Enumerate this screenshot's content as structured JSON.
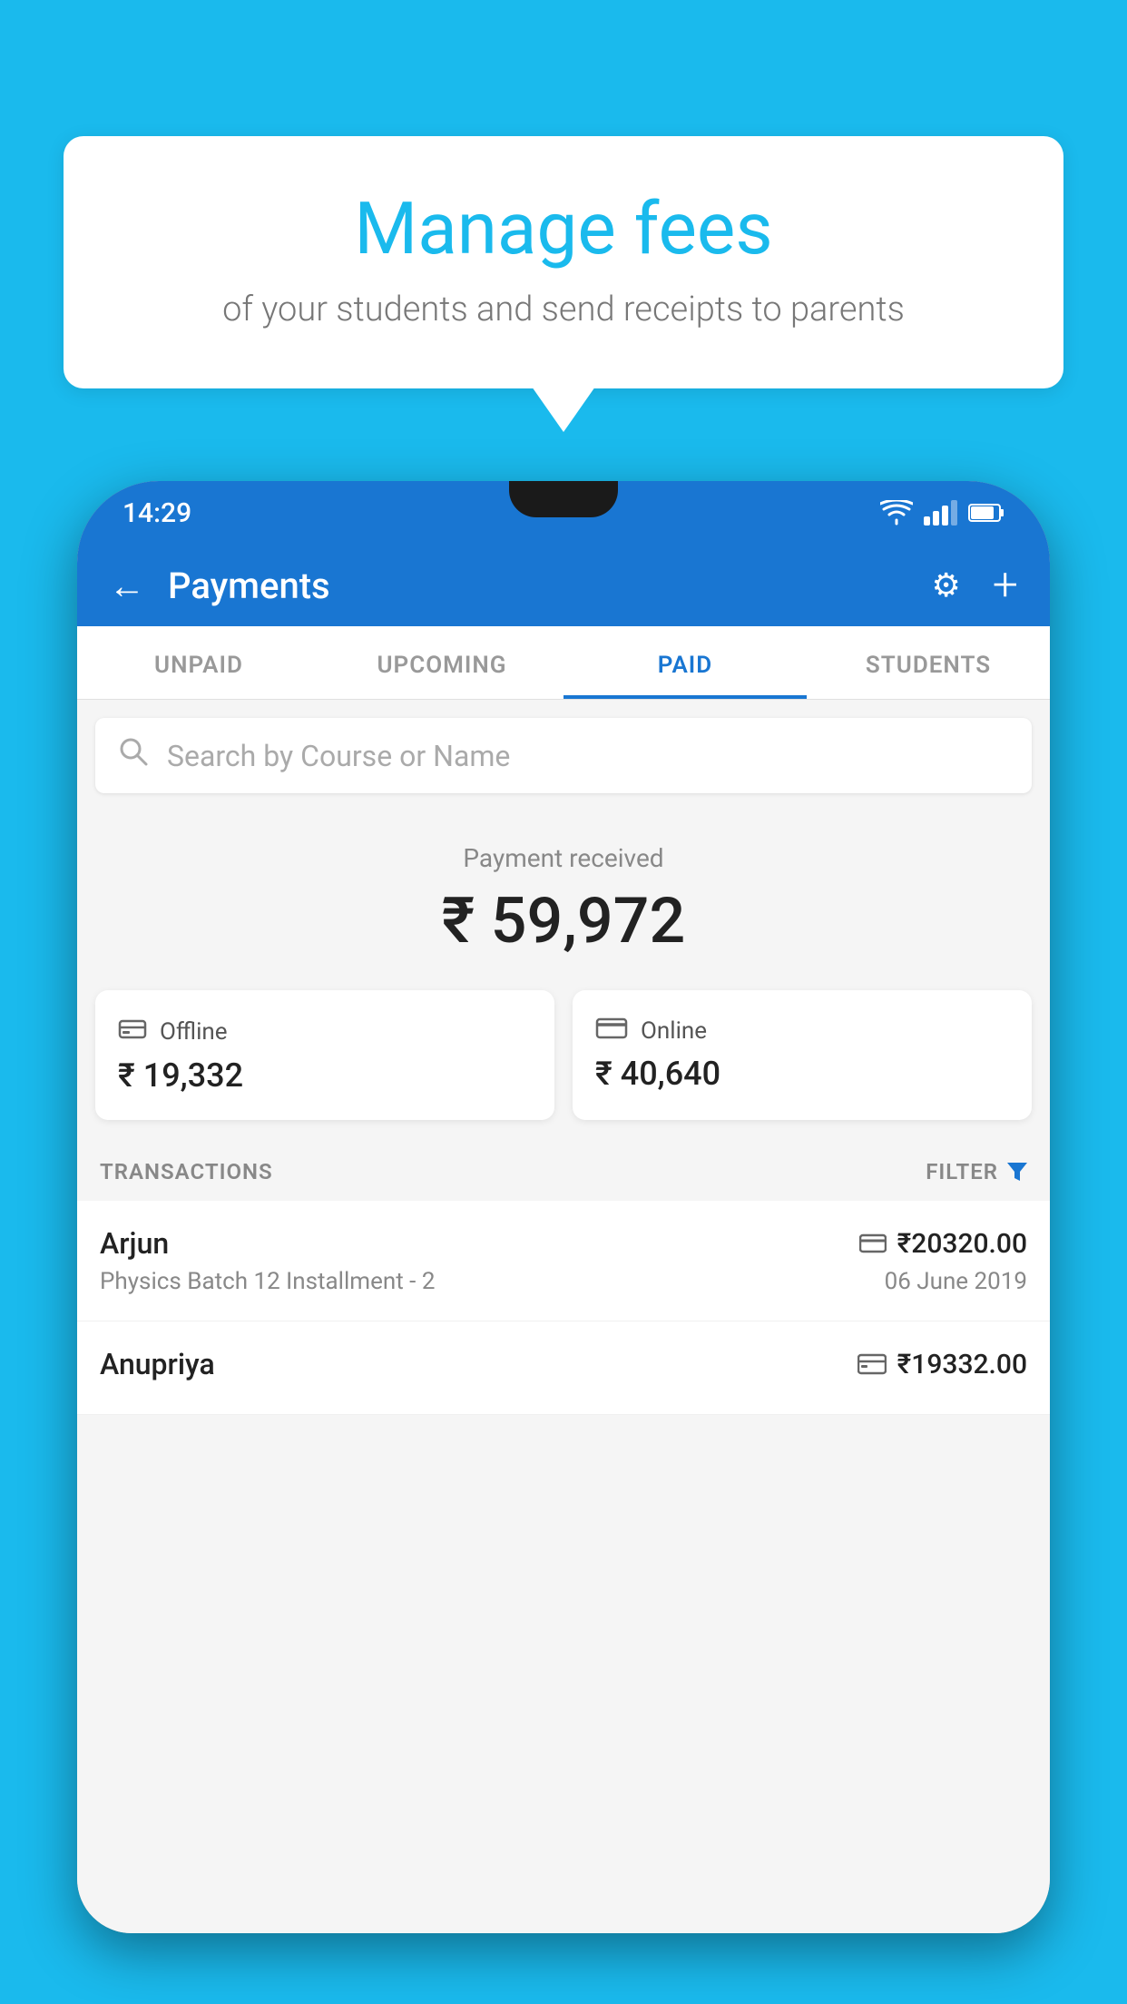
{
  "background_color": "#1ABAED",
  "bubble": {
    "title": "Manage fees",
    "subtitle": "of your students and send receipts to parents"
  },
  "status_bar": {
    "time": "14:29"
  },
  "header": {
    "title": "Payments",
    "back_label": "←",
    "settings_label": "⚙",
    "add_label": "+"
  },
  "tabs": [
    {
      "label": "UNPAID",
      "active": false
    },
    {
      "label": "UPCOMING",
      "active": false
    },
    {
      "label": "PAID",
      "active": true
    },
    {
      "label": "STUDENTS",
      "active": false
    }
  ],
  "search": {
    "placeholder": "Search by Course or Name"
  },
  "payment_received": {
    "label": "Payment received",
    "amount": "₹ 59,972"
  },
  "cards": [
    {
      "icon": "💳",
      "label": "Offline",
      "amount": "₹ 19,332"
    },
    {
      "icon": "💳",
      "label": "Online",
      "amount": "₹ 40,640"
    }
  ],
  "transactions_section": {
    "label": "TRANSACTIONS",
    "filter_label": "FILTER"
  },
  "transactions": [
    {
      "name": "Arjun",
      "course": "Physics Batch 12 Installment - 2",
      "amount": "₹20320.00",
      "date": "06 June 2019",
      "icon": "card"
    },
    {
      "name": "Anupriya",
      "course": "",
      "amount": "₹19332.00",
      "date": "",
      "icon": "cash"
    }
  ]
}
